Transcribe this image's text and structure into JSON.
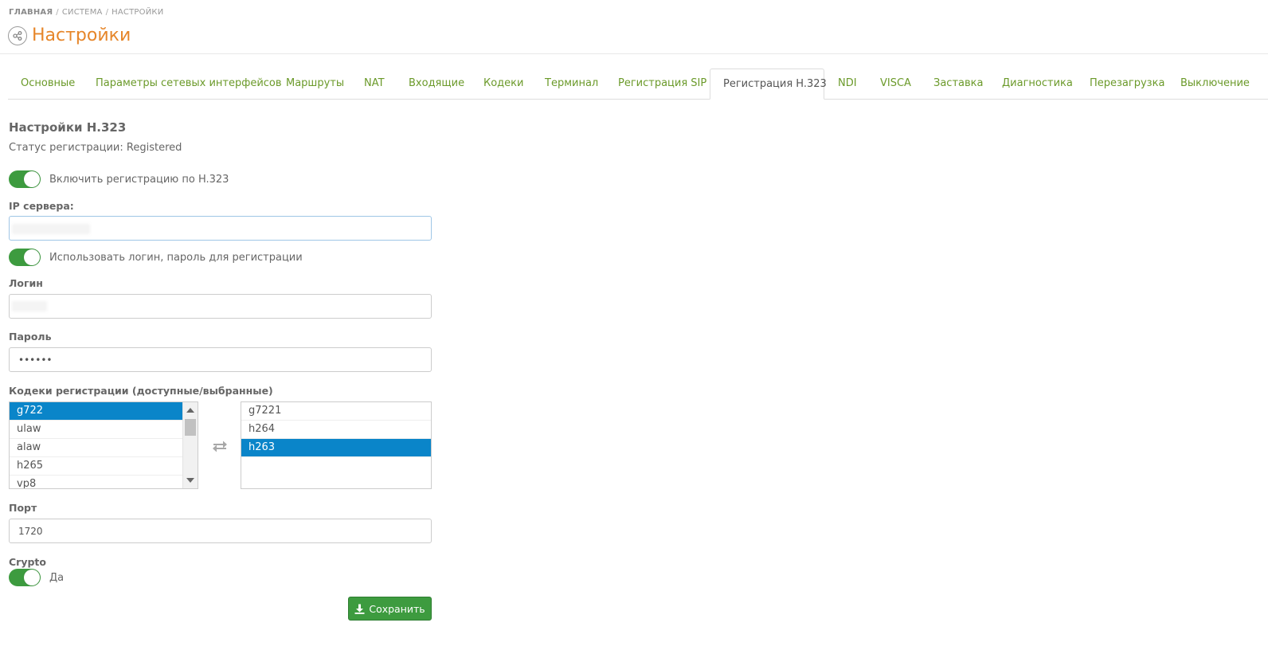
{
  "breadcrumb": {
    "home": "ГЛАВНАЯ",
    "system": "СИСТЕМА",
    "current": "НАСТРОЙКИ",
    "separator": "/"
  },
  "page": {
    "title": "Настройки",
    "icon": "settings-share-icon"
  },
  "tabs": [
    {
      "label": "Основные"
    },
    {
      "label": "Параметры сетевых интерфейсов"
    },
    {
      "label": "Маршруты"
    },
    {
      "label": "NAT"
    },
    {
      "label": "Входящие"
    },
    {
      "label": "Кодеки"
    },
    {
      "label": "Терминал"
    },
    {
      "label": "Регистрация SIP"
    },
    {
      "label": "Регистрация H.323",
      "active": true
    },
    {
      "label": "NDI"
    },
    {
      "label": "VISCA"
    },
    {
      "label": "Заставка"
    },
    {
      "label": "Диагностика"
    },
    {
      "label": "Перезагрузка"
    },
    {
      "label": "Выключение"
    }
  ],
  "form": {
    "section_title": "Настройки H.323",
    "status_label": "Статус регистрации:",
    "status_value": "Registered",
    "enable_registration": {
      "label": "Включить регистрацию по H.323",
      "on": true
    },
    "server_ip": {
      "label": "IP сервера:",
      "value": ""
    },
    "use_credentials": {
      "label": "Использовать логин, пароль для регистрации",
      "on": true
    },
    "login": {
      "label": "Логин",
      "value": ""
    },
    "password": {
      "label": "Пароль",
      "value": "••••••"
    },
    "codecs": {
      "label": "Кодеки регистрации (доступные/выбранные)",
      "available": [
        "g722",
        "ulaw",
        "alaw",
        "h265",
        "vp8"
      ],
      "available_selected": "g722",
      "chosen": [
        "g7221",
        "h264",
        "h263"
      ],
      "chosen_selected": "h263"
    },
    "port": {
      "label": "Порт",
      "value": "1720"
    },
    "crypto": {
      "label": "Crypto",
      "toggle_label": "Да",
      "on": true
    },
    "save_label": "Сохранить"
  },
  "colors": {
    "accent": "#e6862a",
    "link": "#6b9a2a",
    "success": "#3d9b3f",
    "selection": "#0a85c9"
  }
}
